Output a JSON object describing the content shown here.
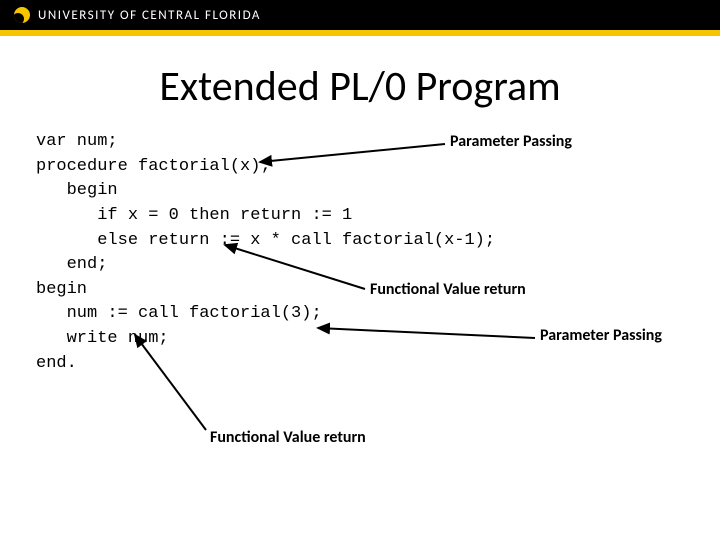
{
  "header": {
    "university": "UNIVERSITY OF CENTRAL FLORIDA"
  },
  "slide": {
    "title": "Extended PL/0 Program"
  },
  "code": {
    "l1": "var num;",
    "l2": "procedure factorial(x);",
    "l3": "   begin",
    "l4": "      if x = 0 then return := 1",
    "l5": "      else return := x * call factorial(x-1);",
    "l6": "   end;",
    "l7": "begin",
    "l8": "   num := call factorial(3);",
    "l9": "   write num;",
    "l10": "end."
  },
  "labels": {
    "param_passing_1": "Parameter Passing",
    "func_value_return_1": "Functional Value return",
    "param_passing_2": "Parameter Passing",
    "func_value_return_2": "Functional Value return"
  }
}
